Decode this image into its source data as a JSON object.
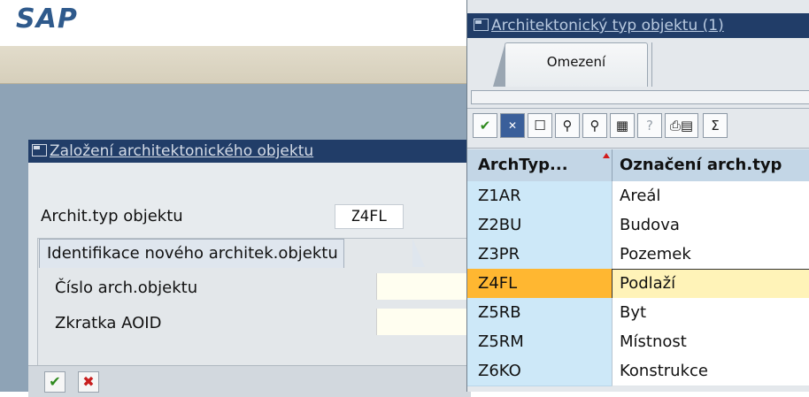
{
  "background": {
    "logo": "SAP"
  },
  "dialog_create": {
    "title": "Založení architektonického objektu",
    "field_type_label": "Archit.typ objektu",
    "field_type_value": "Z4FL",
    "group_title": "Identifikace nového architek.objektu",
    "field_number_label": "Číslo arch.objektu",
    "field_number_value": "",
    "field_short_label": "Zkratka AOID",
    "field_short_value": "",
    "buttons": {
      "confirm_icon": "check-icon",
      "cancel_icon": "cancel-icon"
    }
  },
  "dialog_help": {
    "title": "Architektonický typ objektu (1)",
    "tab_label": "Omezení",
    "toolbar_icons": [
      "check-icon",
      "cancel-icon",
      "new-document-icon",
      "find-icon",
      "find-next-icon",
      "settings-icon",
      "help-icon",
      "print-icon",
      "sum-icon"
    ],
    "table": {
      "columns": [
        "ArchTyp...",
        "Označení arch.typ"
      ],
      "rows": [
        {
          "code": "Z1AR",
          "name": "Areál"
        },
        {
          "code": "Z2BU",
          "name": "Budova"
        },
        {
          "code": "Z3PR",
          "name": "Pozemek"
        },
        {
          "code": "Z4FL",
          "name": "Podlaží"
        },
        {
          "code": "Z5RB",
          "name": "Byt"
        },
        {
          "code": "Z5RM",
          "name": "Místnost"
        },
        {
          "code": "Z6KO",
          "name": "Konstrukce"
        }
      ],
      "selected_code": "Z4FL"
    }
  }
}
